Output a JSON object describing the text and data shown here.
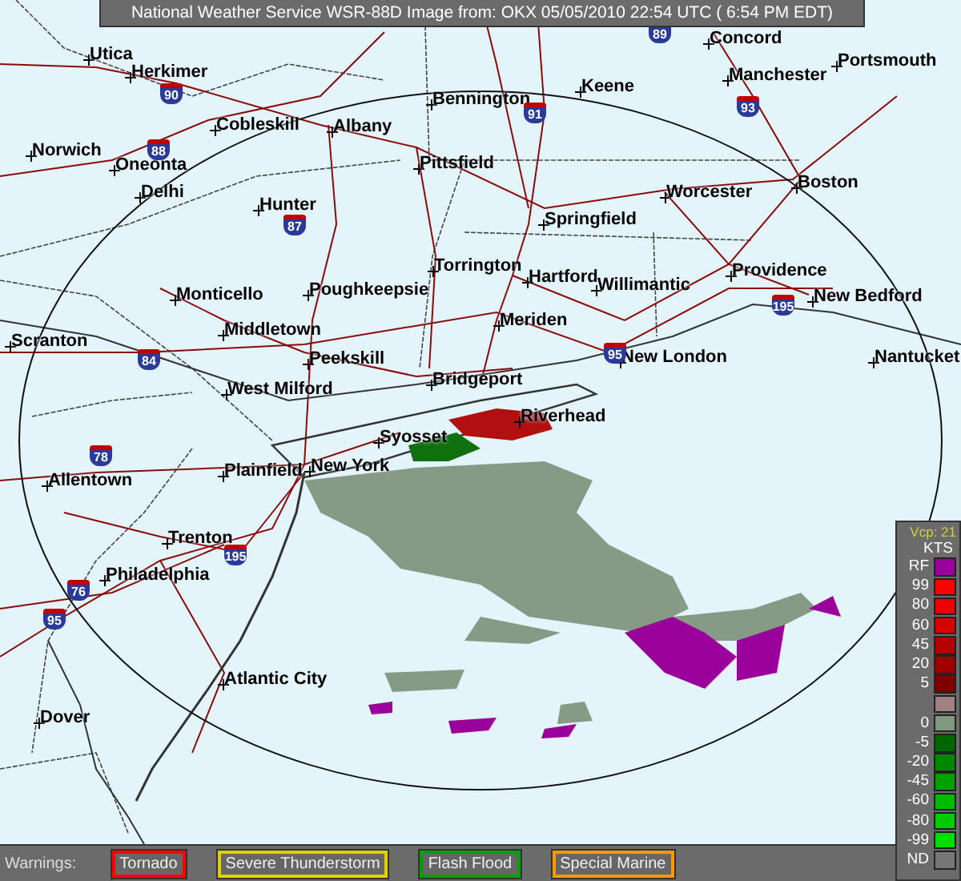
{
  "title": "National Weather Service WSR-88D Image from: OKX 05/05/2010 22:54 UTC ( 6:54 PM EDT)",
  "cities": [
    "Utica",
    "Herkimer",
    "Cobleskill",
    "Albany",
    "Norwich",
    "Oneonta",
    "Delhi",
    "Hunter",
    "Bennington",
    "Keene",
    "Concord",
    "Manchester",
    "Portsmouth",
    "Pittsfield",
    "Worcester",
    "Boston",
    "Springfield",
    "Torrington",
    "Hartford",
    "Willimantic",
    "Providence",
    "New Bedford",
    "Meriden",
    "Monticello",
    "Poughkeepsie",
    "Middletown",
    "Scranton",
    "Peekskill",
    "New London",
    "Nantucket",
    "Bridgeport",
    "West Milford",
    "Riverhead",
    "Syosset",
    "Plainfield",
    "New York",
    "Allentown",
    "Trenton",
    "Philadelphia",
    "Atlantic City",
    "Dover"
  ],
  "shields": [
    "89",
    "90",
    "88",
    "87",
    "91",
    "93",
    "84",
    "95",
    "195",
    "78",
    "195",
    "76",
    "95"
  ],
  "legend": {
    "mode": "Vcp: 21",
    "unit": "KTS",
    "entries": [
      {
        "kind": "single",
        "label": "RF",
        "color": "#990099"
      },
      {
        "kind": "single",
        "label": "99",
        "color": "#ff0000"
      },
      {
        "kind": "single",
        "label": "80",
        "color": "#ee0000"
      },
      {
        "kind": "single",
        "label": "60",
        "color": "#d80000"
      },
      {
        "kind": "single",
        "label": "45",
        "color": "#b40000"
      },
      {
        "kind": "single",
        "label": "20",
        "color": "#a00000"
      },
      {
        "kind": "single",
        "label": "5",
        "color": "#800000"
      },
      {
        "kind": "swatch",
        "color": "#a08080"
      },
      {
        "kind": "single",
        "label": "0",
        "color": "#809880"
      },
      {
        "kind": "single",
        "label": "-5",
        "color": "#006600"
      },
      {
        "kind": "single",
        "label": "-20",
        "color": "#008800"
      },
      {
        "kind": "single",
        "label": "-45",
        "color": "#00a000"
      },
      {
        "kind": "single",
        "label": "-60",
        "color": "#00bb00"
      },
      {
        "kind": "single",
        "label": "-80",
        "color": "#00cc00"
      },
      {
        "kind": "single",
        "label": "-99",
        "color": "#00dd00"
      },
      {
        "kind": "single",
        "label": "ND",
        "color": "#777777"
      }
    ]
  },
  "warnings": {
    "label": "Warnings:",
    "items": [
      {
        "label": "Tornado",
        "color": "#ff0000"
      },
      {
        "label": "Severe Thunderstorm",
        "color": "#e0d000"
      },
      {
        "label": "Flash Flood",
        "color": "#00a000"
      },
      {
        "label": "Special Marine",
        "color": "#ff9900"
      }
    ]
  }
}
